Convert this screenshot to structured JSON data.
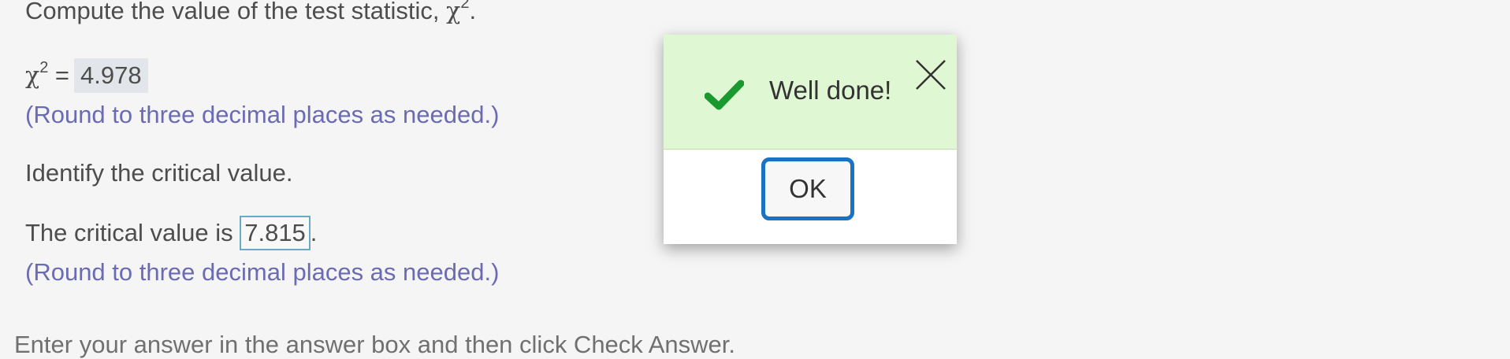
{
  "question": {
    "compute_text": "Compute the value of the test statistic, ",
    "chi_symbol": "χ",
    "exponent": "2",
    "period": ".",
    "equals": " =",
    "chi_value": "4.978",
    "round_hint_1": "(Round to three decimal places as needed.)",
    "identify_text": "Identify the critical value.",
    "critical_prefix": "The critical value is ",
    "critical_value": "7.815",
    "round_hint_2": "(Round to three decimal places as needed.)",
    "footer_text": "Enter your answer in the answer box and then click Check Answer."
  },
  "dialog": {
    "message": "Well done!",
    "ok_label": "OK",
    "header_color": "#e0f7d3",
    "check_color": "#1a9a2e",
    "button_border_color": "#1a72c4"
  }
}
